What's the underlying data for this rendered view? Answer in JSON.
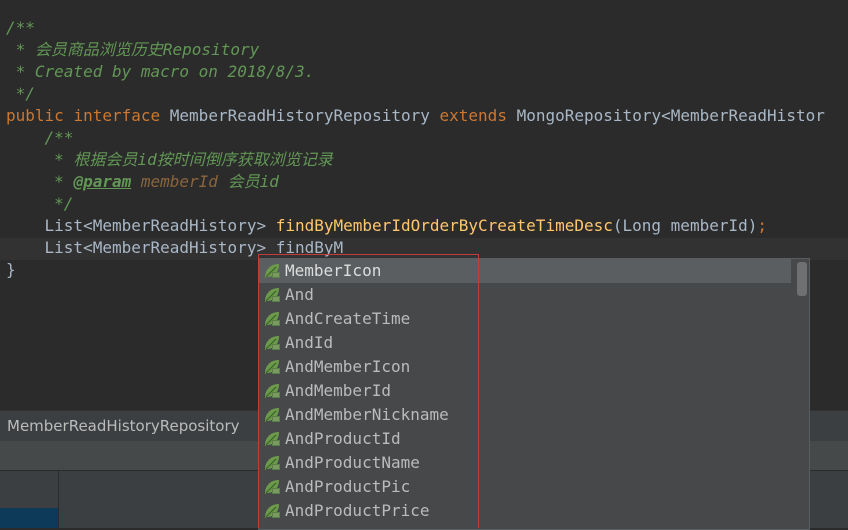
{
  "code": {
    "line1": "/**",
    "line2": " * 会员商品浏览历史Repository",
    "line3": " * Created by macro on 2018/8/3.",
    "line4": " */",
    "line5_kw1": "public",
    "line5_kw2": "interface",
    "line5_name": "MemberReadHistoryRepository",
    "line5_kw3": "extends",
    "line5_rest": "MongoRepository<MemberReadHistor",
    "line6": "    /**",
    "line7": "     * 根据会员id按时间倒序获取浏览记录",
    "line8_prefix": "     * ",
    "line8_tag": "@param",
    "line8_param": "memberId",
    "line8_desc": " 会员id",
    "line9": "     */",
    "line10_type": "    List<MemberReadHistory> ",
    "line10_fn": "findByMemberIdOrderByCreateTimeDesc",
    "line10_args": "(Long memberId)",
    "line10_semi": ";",
    "line11_type": "    List<MemberReadHistory> ",
    "line11_typed": "findByM",
    "line12": "}"
  },
  "status": {
    "breadcrumb": "MemberReadHistoryRepository"
  },
  "completion": {
    "items": [
      "MemberIcon",
      "And",
      "AndCreateTime",
      "AndId",
      "AndMemberIcon",
      "AndMemberId",
      "AndMemberNickname",
      "AndProductId",
      "AndProductName",
      "AndProductPic",
      "AndProductPrice"
    ],
    "selected_index": 0,
    "item_icon": "spring-leaf-icon"
  },
  "colors": {
    "background": "#2b2b2b",
    "doc_comment": "#629755",
    "keyword": "#cc7832",
    "method": "#ffc66d",
    "highlight_box": "#c43b3b"
  }
}
